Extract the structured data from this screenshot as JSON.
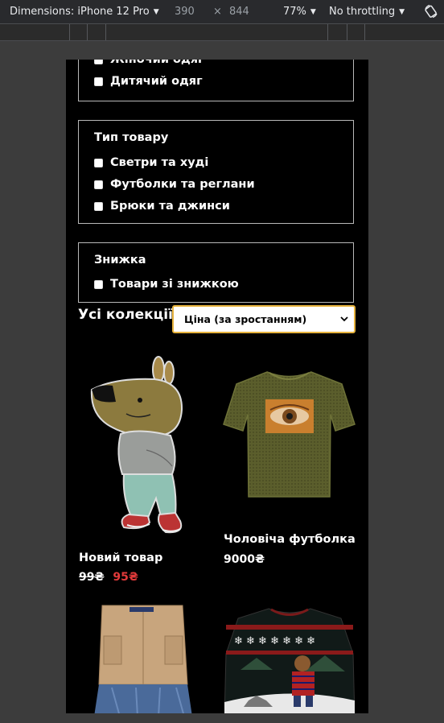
{
  "devtools": {
    "dimensions_label": "Dimensions: iPhone 12 Pro",
    "width": "390",
    "times": "×",
    "height": "844",
    "zoom": "77%",
    "throttling": "No throttling"
  },
  "filters": {
    "category_group": {
      "options": [
        "Жіночий одяг",
        "Дитячий одяг"
      ]
    },
    "product_type": {
      "title": "Тип товару",
      "options": [
        "Светри та худі",
        "Футболки та реглани",
        "Брюки та джинси"
      ]
    },
    "discount": {
      "title": "Знижка",
      "options": [
        "Товари зі знижкою"
      ]
    }
  },
  "collection": {
    "title": "Усі колекції",
    "sort_selected": "Ціна (за зростанням)"
  },
  "products": [
    {
      "name": "Новий товар",
      "old_price": "99₴",
      "price": "95₴"
    },
    {
      "name": "Чоловіча футболка",
      "price": "9000₴"
    }
  ],
  "colors": {
    "accent": "#e7b33d",
    "sale": "#e23a3a"
  }
}
